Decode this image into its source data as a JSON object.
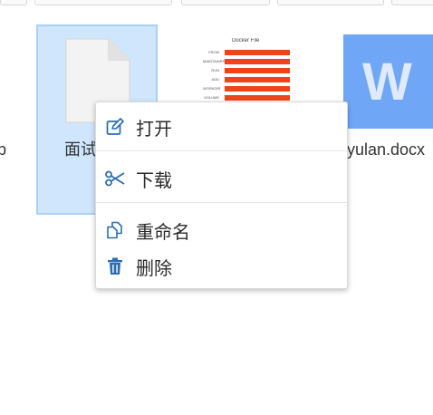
{
  "files": [
    {
      "name": "p"
    },
    {
      "name": "面试"
    },
    {
      "name": "yulan.docx"
    }
  ],
  "thumbnail": {
    "title": "Docker File",
    "rows": [
      "FROM",
      "MAINTAINER",
      "RUN",
      "ADD",
      "WORKDIR",
      "VOLUME"
    ]
  },
  "word_icon": {
    "letter": "W"
  },
  "context_menu": {
    "items": [
      {
        "label": "打开",
        "icon": "edit-icon"
      },
      {
        "label": "下载",
        "icon": "scissors-icon"
      },
      {
        "label": "重命名",
        "icon": "copy-icon"
      },
      {
        "label": "删除",
        "icon": "trash-icon"
      }
    ]
  },
  "colors": {
    "accent_icon": "#2a6db3",
    "selection_bg": "#cfe6fd",
    "selection_border": "#a9d0f7",
    "word_tile": "#6fa7f6"
  }
}
